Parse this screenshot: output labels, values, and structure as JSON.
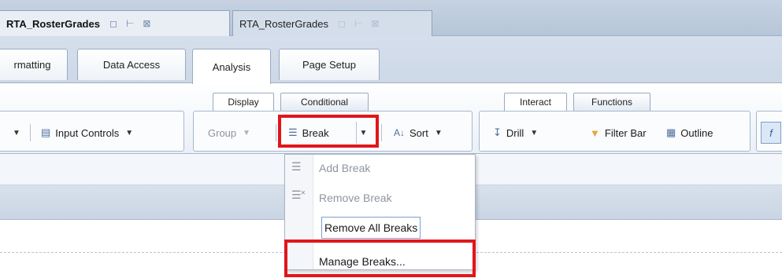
{
  "document_tabs": [
    {
      "label": "RTA_RosterGrades",
      "state": "active"
    },
    {
      "label": "RTA_RosterGrades",
      "state": "inactive"
    }
  ],
  "main_tabs": [
    "rmatting",
    "Data Access",
    "Analysis",
    "Page Setup"
  ],
  "group_tabs": {
    "display": "Display",
    "conditional": "Conditional",
    "interact": "Interact",
    "functions": "Functions"
  },
  "toolbar": {
    "input_controls": "Input Controls",
    "group": "Group",
    "break": "Break",
    "sort": "Sort",
    "drill": "Drill",
    "filter_bar": "Filter Bar",
    "outline": "Outline"
  },
  "break_menu": {
    "add_break": "Add Break",
    "remove_break": "Remove Break",
    "remove_all_breaks": "Remove All Breaks",
    "manage_breaks": "Manage Breaks..."
  },
  "colors": {
    "highlight": "#e0161b",
    "tab_background": "#c6d2e2",
    "toolbar_background": "#eaf0f8"
  }
}
